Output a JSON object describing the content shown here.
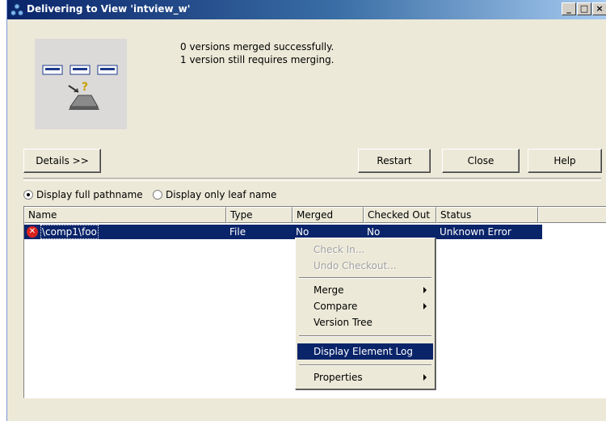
{
  "window": {
    "title": "Delivering to View 'intview_w'",
    "controls": [
      "_",
      "□",
      "×"
    ]
  },
  "status": {
    "line1": "0 versions merged successfully.",
    "line2": "1 version still requires merging."
  },
  "buttons": {
    "details": "Details >>",
    "restart": "Restart",
    "close": "Close",
    "help": "Help"
  },
  "display_options": {
    "full_pathname": "Display full pathname",
    "leaf_name": "Display only leaf name",
    "selected": "full_pathname"
  },
  "table": {
    "columns": [
      "Name",
      "Type",
      "Merged",
      "Checked Out",
      "Status"
    ],
    "rows": [
      {
        "name": "\\comp1\\foo",
        "type": "File",
        "merged": "No",
        "checked_out": "No",
        "status": "Unknown Error",
        "icon": "error-icon"
      }
    ]
  },
  "context_menu": {
    "items": [
      {
        "label": "Check In...",
        "enabled": false
      },
      {
        "label": "Undo Checkout...",
        "enabled": false
      },
      {
        "label": "Merge",
        "submenu": true
      },
      {
        "label": "Compare",
        "submenu": true
      },
      {
        "label": "Version Tree"
      },
      {
        "label": "Display Element Log",
        "highlighted": true
      },
      {
        "label": "Properties",
        "submenu": true
      }
    ]
  },
  "colors": {
    "title_bar": "#0a246a",
    "selection": "#0a246a",
    "error": "#d8231f",
    "face": "#ece9d8"
  }
}
